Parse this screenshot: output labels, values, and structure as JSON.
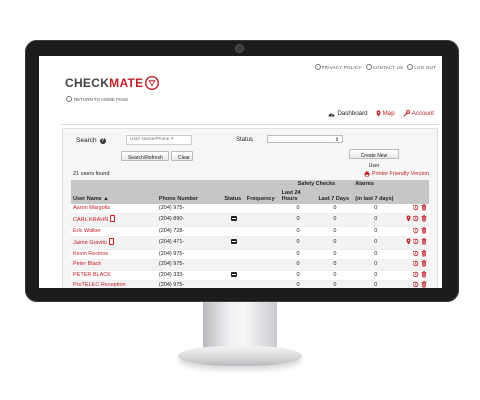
{
  "header": {
    "top_links": [
      "PRIVACY POLICY",
      "CONTACT US",
      "LOG OUT"
    ],
    "logo_text_a": "CHECK",
    "logo_text_b": "MATE",
    "return_link": "RETURN TO HOME PAGE",
    "nav": {
      "dashboard": "Dashboard",
      "map": "Map",
      "account": "Account"
    }
  },
  "search": {
    "label": "Search",
    "placeholder": "User Name/Phone #",
    "status_label": "Status",
    "status_value": "",
    "search_button": "Search/Refresh",
    "clear_button": "Clear",
    "new_user_button": "Create New User"
  },
  "results": {
    "count_text": "21 users found",
    "printer_link": "Printer Friendly Version"
  },
  "table": {
    "group_headers": {
      "safety": "Safety Checks",
      "alarms": "Alarms"
    },
    "headers": {
      "user_name": "User Name ▲",
      "phone": "Phone Number",
      "status": "Status",
      "frequency": "Frequency",
      "last24": "Last 24 Hours",
      "last7": "Last 7 Days",
      "alarms7": "(in last 7 days)"
    },
    "rows": [
      {
        "name": "Aaron Margolis",
        "phone": "(204) 975-",
        "status": false,
        "mobile": false,
        "last24": "0",
        "last7": "0",
        "alarms": "0",
        "map": false
      },
      {
        "name": "CARL KRAHN",
        "phone": "(204) 890-",
        "status": true,
        "mobile": true,
        "last24": "0",
        "last7": "0",
        "alarms": "0",
        "map": true
      },
      {
        "name": "Eric Walker",
        "phone": "(204) 728-",
        "status": false,
        "mobile": false,
        "last24": "0",
        "last7": "0",
        "alarms": "0",
        "map": false
      },
      {
        "name": "Jaime Gravito",
        "phone": "(204) 471-",
        "status": true,
        "mobile": true,
        "last24": "0",
        "last7": "0",
        "alarms": "0",
        "map": true
      },
      {
        "name": "Kevin Recinos",
        "phone": "(204) 975-",
        "status": false,
        "mobile": false,
        "last24": "0",
        "last7": "0",
        "alarms": "0",
        "map": false
      },
      {
        "name": "Peter Black",
        "phone": "(204) 975-",
        "status": false,
        "mobile": false,
        "last24": "0",
        "last7": "0",
        "alarms": "0",
        "map": false
      },
      {
        "name": "PETER BLACK",
        "phone": "(204) 333-",
        "status": true,
        "mobile": false,
        "last24": "0",
        "last7": "0",
        "alarms": "0",
        "map": false
      },
      {
        "name": "ProTELEC Reception",
        "phone": "(204) 975-",
        "status": false,
        "mobile": false,
        "last24": "0",
        "last7": "0",
        "alarms": "0",
        "map": false
      }
    ]
  },
  "colors": {
    "accent": "#c01f24",
    "header_gray": "#c6c6c6",
    "bezel": "#1c1c1e"
  }
}
